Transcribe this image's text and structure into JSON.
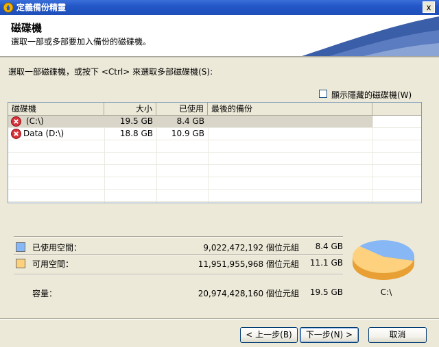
{
  "window": {
    "title": "定義備份精靈",
    "close_glyph": "x"
  },
  "header": {
    "title": "磁碟機",
    "subtitle": "選取一部或多部要加入備份的磁碟機。"
  },
  "prompt": "選取一部磁碟機，或按下 <Ctrl> 來選取多部磁碟機(S):",
  "hidden_checkbox": {
    "label": "顯示隱藏的磁碟機(W)",
    "checked": false
  },
  "table": {
    "columns": [
      "磁碟機",
      "大小",
      "已使用",
      "最後的備份"
    ],
    "rows": [
      {
        "drive": "(C:\\)",
        "size": "19.5 GB",
        "used": "8.4 GB",
        "last_backup": "",
        "selected": true,
        "icon": "error-icon"
      },
      {
        "drive": "Data (D:\\)",
        "size": "18.8 GB",
        "used": "10.9 GB",
        "last_backup": "",
        "selected": false,
        "icon": "error-icon"
      }
    ]
  },
  "summary": {
    "used": {
      "label": "已使用空間：",
      "bytes": "9,022,472,192 個位元組",
      "size": "8.4 GB",
      "color": "#87b7f5"
    },
    "free": {
      "label": "可用空間：",
      "bytes": "11,951,955,968 個位元組",
      "size": "11.1 GB",
      "color": "#fdd17d"
    },
    "capacity": {
      "label": "容量：",
      "bytes": "20,974,428,160 個位元組",
      "size": "19.5 GB"
    },
    "pie_caption": "C:\\",
    "used_fraction": 0.43
  },
  "buttons": {
    "back": "< 上一步(B)",
    "next": "下一步(N) >",
    "cancel": "取消"
  }
}
